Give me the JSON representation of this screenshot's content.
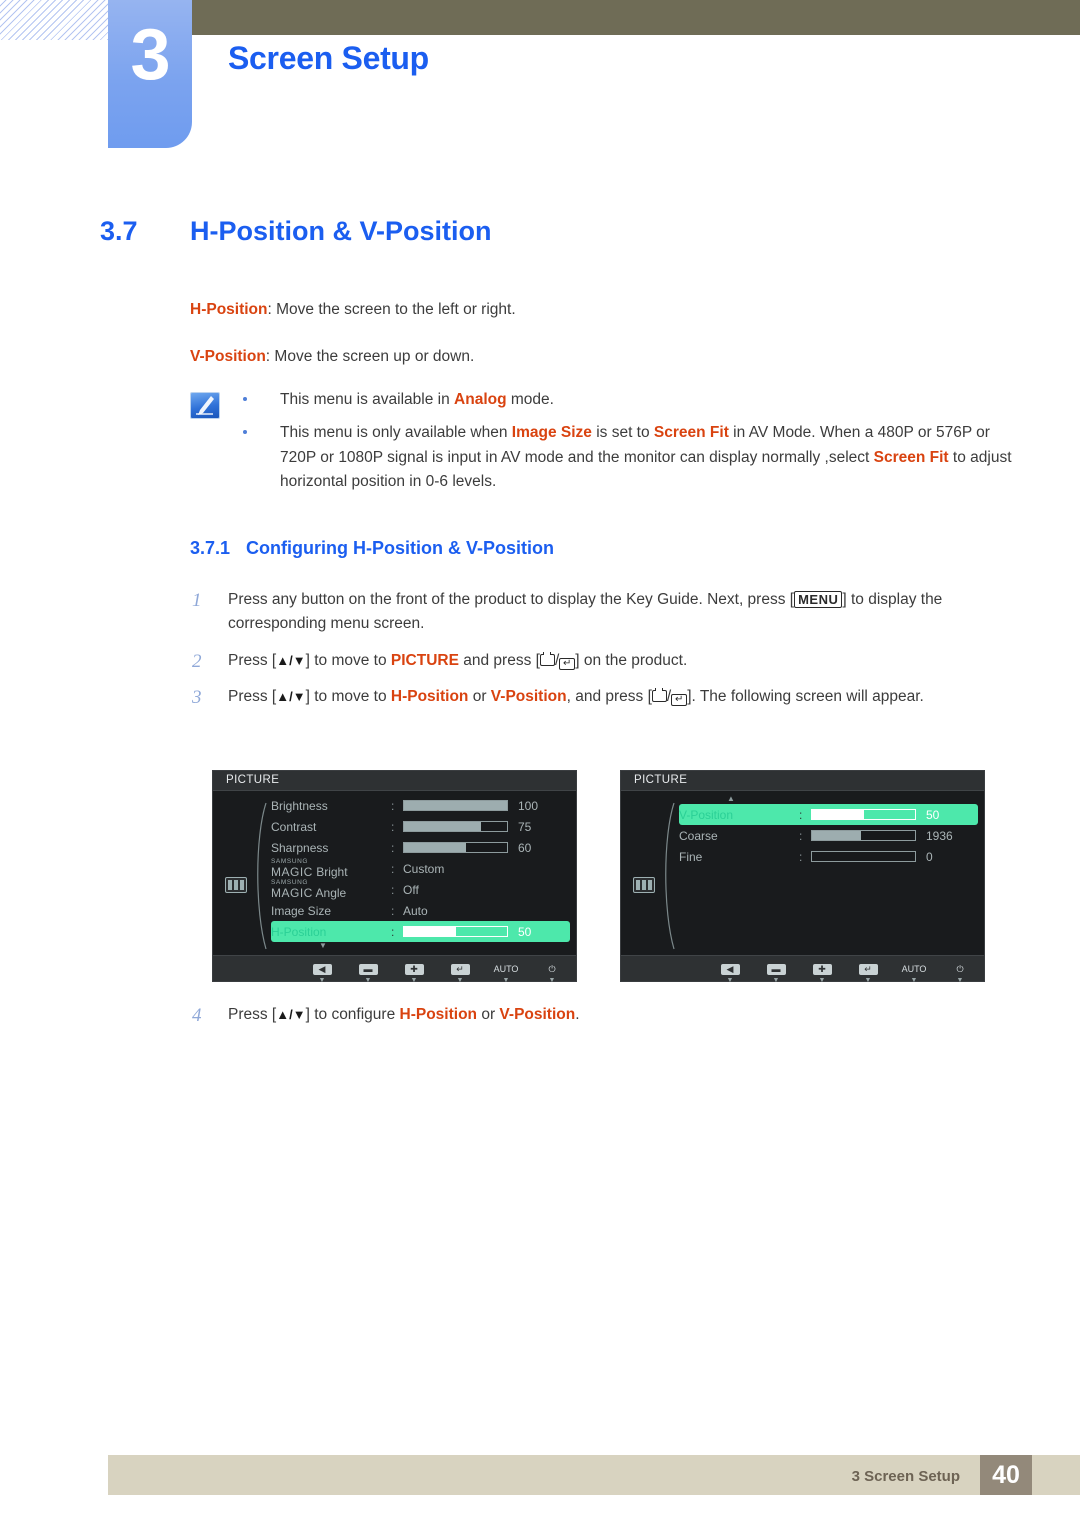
{
  "header": {
    "chapter_number": "3",
    "chapter_title": "Screen Setup"
  },
  "section": {
    "number": "3.7",
    "title": "H-Position & V-Position"
  },
  "intro": {
    "line1_term": "H-Position",
    "line1_rest": ": Move the screen to the left or right.",
    "line2_term": "V-Position",
    "line2_rest": ": Move the screen up or down."
  },
  "notes": {
    "icon": "note-pen-icon",
    "items": [
      {
        "pre": "This menu is available in ",
        "term1": "Analog",
        "post": " mode."
      },
      {
        "pre": "This menu is only available when ",
        "term1": "Image Size",
        "mid1": " is set to ",
        "term2": "Screen Fit",
        "mid2": " in AV Mode. When a 480P or 576P or 720P or 1080P signal is input in AV mode and the monitor can display normally ,select ",
        "term3": "Screen Fit",
        "post": " to adjust horizontal position in 0-6 levels."
      }
    ]
  },
  "subsection": {
    "number": "3.7.1",
    "title": "Configuring H-Position & V-Position"
  },
  "steps": [
    {
      "num": "1",
      "parts": [
        {
          "t": "Press any button on the front of the product to display the Key Guide. Next, press ["
        },
        {
          "key": "MENU"
        },
        {
          "t": "] to display the corresponding menu screen."
        }
      ]
    },
    {
      "num": "2",
      "parts": [
        {
          "t": "Press ["
        },
        {
          "arrows": "▲/▼"
        },
        {
          "t": "] to move to "
        },
        {
          "red": "PICTURE"
        },
        {
          "t": " and press ["
        },
        {
          "glyph": "box"
        },
        {
          "t": "/"
        },
        {
          "glyph": "enter"
        },
        {
          "t": "] on the product."
        }
      ]
    },
    {
      "num": "3",
      "parts": [
        {
          "t": "Press ["
        },
        {
          "arrows": "▲/▼"
        },
        {
          "t": "] to move to "
        },
        {
          "red": "H-Position"
        },
        {
          "t": " or "
        },
        {
          "red": "V-Position"
        },
        {
          "t": ", and press ["
        },
        {
          "glyph": "box"
        },
        {
          "t": "/"
        },
        {
          "glyph": "enter"
        },
        {
          "t": "]. The following screen will appear."
        }
      ]
    },
    {
      "num": "4",
      "parts": [
        {
          "t": "Press ["
        },
        {
          "arrows": "▲/▼"
        },
        {
          "t": "] to configure "
        },
        {
          "red": "H-Position"
        },
        {
          "t": " or "
        },
        {
          "red": "V-Position"
        },
        {
          "t": "."
        }
      ]
    }
  ],
  "osd_left": {
    "title": "PICTURE",
    "side_icon": "picture-bars-icon",
    "scroll_up": false,
    "scroll_down": true,
    "rows": [
      {
        "label": "Brightness",
        "type": "bar",
        "fill": 100,
        "value": "100",
        "highlight": false
      },
      {
        "label": "Contrast",
        "type": "bar",
        "fill": 75,
        "value": "75",
        "highlight": false
      },
      {
        "label": "Sharpness",
        "type": "bar",
        "fill": 60,
        "value": "60",
        "highlight": false
      },
      {
        "label": "MAGIC Bright",
        "magic": true,
        "magic_sup": "SAMSUNG",
        "magic_main": "MAGIC",
        "magic_suffix": "Bright",
        "type": "text",
        "value": "Custom",
        "highlight": false
      },
      {
        "label": "MAGIC Angle",
        "magic": true,
        "magic_sup": "SAMSUNG",
        "magic_main": "MAGIC",
        "magic_suffix": "Angle",
        "type": "text",
        "value": "Off",
        "highlight": false
      },
      {
        "label": "Image Size",
        "type": "text",
        "value": "Auto",
        "highlight": false
      },
      {
        "label": "H-Position",
        "type": "bar",
        "fill": 50,
        "value": "50",
        "highlight": true
      }
    ],
    "footer_buttons": [
      {
        "name": "back",
        "glyph": "◀"
      },
      {
        "name": "minus",
        "glyph": "▬"
      },
      {
        "name": "plus",
        "glyph": "✚"
      },
      {
        "name": "enter",
        "glyph": "↵"
      },
      {
        "name": "auto",
        "glyph": "AUTO"
      },
      {
        "name": "power",
        "glyph": "⏻"
      }
    ]
  },
  "osd_right": {
    "title": "PICTURE",
    "side_icon": "picture-bars-icon",
    "scroll_up": true,
    "scroll_down": false,
    "rows": [
      {
        "label": "V-Position",
        "type": "bar",
        "fill": 50,
        "value": "50",
        "highlight": true
      },
      {
        "label": "Coarse",
        "type": "bar",
        "fill": 48,
        "value": "1936",
        "highlight": false
      },
      {
        "label": "Fine",
        "type": "bar",
        "fill": 0,
        "value": "0",
        "highlight": false
      }
    ],
    "footer_buttons": [
      {
        "name": "back",
        "glyph": "◀"
      },
      {
        "name": "minus",
        "glyph": "▬"
      },
      {
        "name": "plus",
        "glyph": "✚"
      },
      {
        "name": "enter",
        "glyph": "↵"
      },
      {
        "name": "auto",
        "glyph": "AUTO"
      },
      {
        "name": "power",
        "glyph": "⏻"
      }
    ]
  },
  "footer": {
    "text": "3 Screen Setup",
    "page": "40"
  },
  "colors": {
    "accent_blue": "#1b5ef0",
    "term_red": "#d94310",
    "osd_green": "#4de8ab",
    "header_olive": "#6f6c56",
    "footer_tan": "#d8d3c0",
    "footer_page_brown": "#93897a"
  }
}
